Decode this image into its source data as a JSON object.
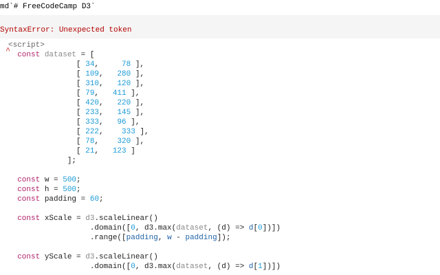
{
  "md_cell": {
    "text": "md`# FreeCodeCamp D3`"
  },
  "error": {
    "text": "SyntaxError: Unexpected token"
  },
  "caret": {
    "glyph": "^"
  },
  "code": {
    "l0": [
      {
        "t": "<script>",
        "c": "tag"
      }
    ],
    "l1": [
      {
        "t": "  ",
        "c": ""
      },
      {
        "t": "const",
        "c": "kw"
      },
      {
        "t": " ",
        "c": ""
      },
      {
        "t": "dataset",
        "c": "var"
      },
      {
        "t": " = [",
        "c": ""
      }
    ],
    "l2": [
      {
        "t": "               [ ",
        "c": ""
      },
      {
        "t": "34",
        "c": "num"
      },
      {
        "t": ",     ",
        "c": ""
      },
      {
        "t": "78",
        "c": "num"
      },
      {
        "t": " ],",
        "c": ""
      }
    ],
    "l3": [
      {
        "t": "               [ ",
        "c": ""
      },
      {
        "t": "109",
        "c": "num"
      },
      {
        "t": ",   ",
        "c": ""
      },
      {
        "t": "280",
        "c": "num"
      },
      {
        "t": " ],",
        "c": ""
      }
    ],
    "l4": [
      {
        "t": "               [ ",
        "c": ""
      },
      {
        "t": "310",
        "c": "num"
      },
      {
        "t": ",   ",
        "c": ""
      },
      {
        "t": "120",
        "c": "num"
      },
      {
        "t": " ],",
        "c": ""
      }
    ],
    "l5": [
      {
        "t": "               [ ",
        "c": ""
      },
      {
        "t": "79",
        "c": "num"
      },
      {
        "t": ",   ",
        "c": ""
      },
      {
        "t": "411",
        "c": "num"
      },
      {
        "t": " ],",
        "c": ""
      }
    ],
    "l6": [
      {
        "t": "               [ ",
        "c": ""
      },
      {
        "t": "420",
        "c": "num"
      },
      {
        "t": ",   ",
        "c": ""
      },
      {
        "t": "220",
        "c": "num"
      },
      {
        "t": " ],",
        "c": ""
      }
    ],
    "l7": [
      {
        "t": "               [ ",
        "c": ""
      },
      {
        "t": "233",
        "c": "num"
      },
      {
        "t": ",   ",
        "c": ""
      },
      {
        "t": "145",
        "c": "num"
      },
      {
        "t": " ],",
        "c": ""
      }
    ],
    "l8": [
      {
        "t": "               [ ",
        "c": ""
      },
      {
        "t": "333",
        "c": "num"
      },
      {
        "t": ",   ",
        "c": ""
      },
      {
        "t": "96",
        "c": "num"
      },
      {
        "t": " ],",
        "c": ""
      }
    ],
    "l9": [
      {
        "t": "               [ ",
        "c": ""
      },
      {
        "t": "222",
        "c": "num"
      },
      {
        "t": ",    ",
        "c": ""
      },
      {
        "t": "333",
        "c": "num"
      },
      {
        "t": " ],",
        "c": ""
      }
    ],
    "l10": [
      {
        "t": "               [ ",
        "c": ""
      },
      {
        "t": "78",
        "c": "num"
      },
      {
        "t": ",    ",
        "c": ""
      },
      {
        "t": "320",
        "c": "num"
      },
      {
        "t": " ],",
        "c": ""
      }
    ],
    "l11": [
      {
        "t": "               [ ",
        "c": ""
      },
      {
        "t": "21",
        "c": "num"
      },
      {
        "t": ",   ",
        "c": ""
      },
      {
        "t": "123",
        "c": "num"
      },
      {
        "t": " ]",
        "c": ""
      }
    ],
    "l12": [
      {
        "t": "             ];",
        "c": ""
      }
    ],
    "l14": [
      {
        "t": "  ",
        "c": ""
      },
      {
        "t": "const",
        "c": "kw"
      },
      {
        "t": " w = ",
        "c": ""
      },
      {
        "t": "500",
        "c": "num"
      },
      {
        "t": ";",
        "c": ""
      }
    ],
    "l15": [
      {
        "t": "  ",
        "c": ""
      },
      {
        "t": "const",
        "c": "kw"
      },
      {
        "t": " h = ",
        "c": ""
      },
      {
        "t": "500",
        "c": "num"
      },
      {
        "t": ";",
        "c": ""
      }
    ],
    "l16": [
      {
        "t": "  ",
        "c": ""
      },
      {
        "t": "const",
        "c": "kw"
      },
      {
        "t": " padding = ",
        "c": ""
      },
      {
        "t": "60",
        "c": "num"
      },
      {
        "t": ";",
        "c": ""
      }
    ],
    "l18": [
      {
        "t": "  ",
        "c": ""
      },
      {
        "t": "const",
        "c": "kw"
      },
      {
        "t": " xScale = ",
        "c": ""
      },
      {
        "t": "d3",
        "c": "var"
      },
      {
        "t": ".scaleLinear()",
        "c": ""
      }
    ],
    "l19": [
      {
        "t": "                  .domain([",
        "c": ""
      },
      {
        "t": "0",
        "c": "num"
      },
      {
        "t": ", d3.max(",
        "c": ""
      },
      {
        "t": "dataset",
        "c": "var"
      },
      {
        "t": ", (d) => ",
        "c": ""
      },
      {
        "t": "d",
        "c": "blue"
      },
      {
        "t": "[",
        "c": ""
      },
      {
        "t": "0",
        "c": "num"
      },
      {
        "t": "])])",
        "c": ""
      }
    ],
    "l20": [
      {
        "t": "                  .range([",
        "c": ""
      },
      {
        "t": "padding",
        "c": "blue"
      },
      {
        "t": ", ",
        "c": ""
      },
      {
        "t": "w",
        "c": "blue"
      },
      {
        "t": " - ",
        "c": ""
      },
      {
        "t": "padding",
        "c": "blue"
      },
      {
        "t": "]);",
        "c": ""
      }
    ],
    "l22": [
      {
        "t": "  ",
        "c": ""
      },
      {
        "t": "const",
        "c": "kw"
      },
      {
        "t": " yScale = ",
        "c": ""
      },
      {
        "t": "d3",
        "c": "var"
      },
      {
        "t": ".scaleLinear()",
        "c": ""
      }
    ],
    "l23": [
      {
        "t": "                  .domain([",
        "c": ""
      },
      {
        "t": "0",
        "c": "num"
      },
      {
        "t": ", d3.max(",
        "c": ""
      },
      {
        "t": "dataset",
        "c": "var"
      },
      {
        "t": ", (d) => ",
        "c": ""
      },
      {
        "t": "d",
        "c": "blue"
      },
      {
        "t": "[",
        "c": ""
      },
      {
        "t": "1",
        "c": "num"
      },
      {
        "t": "])])",
        "c": ""
      }
    ]
  }
}
